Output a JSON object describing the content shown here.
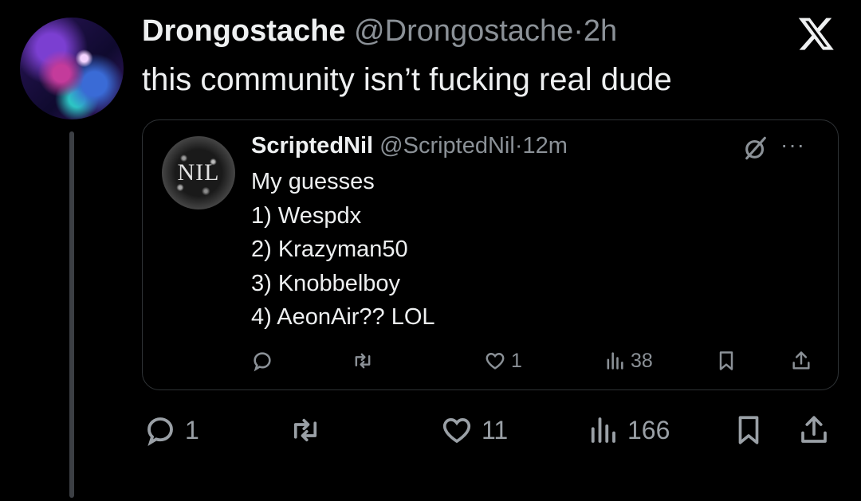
{
  "tweet": {
    "display_name": "Drongostache",
    "handle": "@Drongostache",
    "separator": "·",
    "time": "2h",
    "text": "this community isn’t fucking real dude",
    "avatar_icon": "avatar-astronaut",
    "platform_icon": "x-logo-icon"
  },
  "quote": {
    "display_name": "ScriptedNil",
    "handle": "@ScriptedNil",
    "separator": "·",
    "time": "12m",
    "avatar_text": "NIL",
    "lines": [
      "My guesses",
      "1) Wespdx",
      "2) Krazyman50",
      "3) Knobbelboy",
      "4) AeonAir?? LOL"
    ],
    "more_label": "···",
    "actions": {
      "reply_count": "",
      "retweet_count": "",
      "like_count": "1",
      "views_count": "38"
    }
  },
  "actions": {
    "reply_count": "1",
    "retweet_count": "",
    "like_count": "11",
    "views_count": "166"
  },
  "colors": {
    "background": "#000000",
    "text": "#e7e9ea",
    "secondary": "#8b9197",
    "border": "#2f3336"
  }
}
